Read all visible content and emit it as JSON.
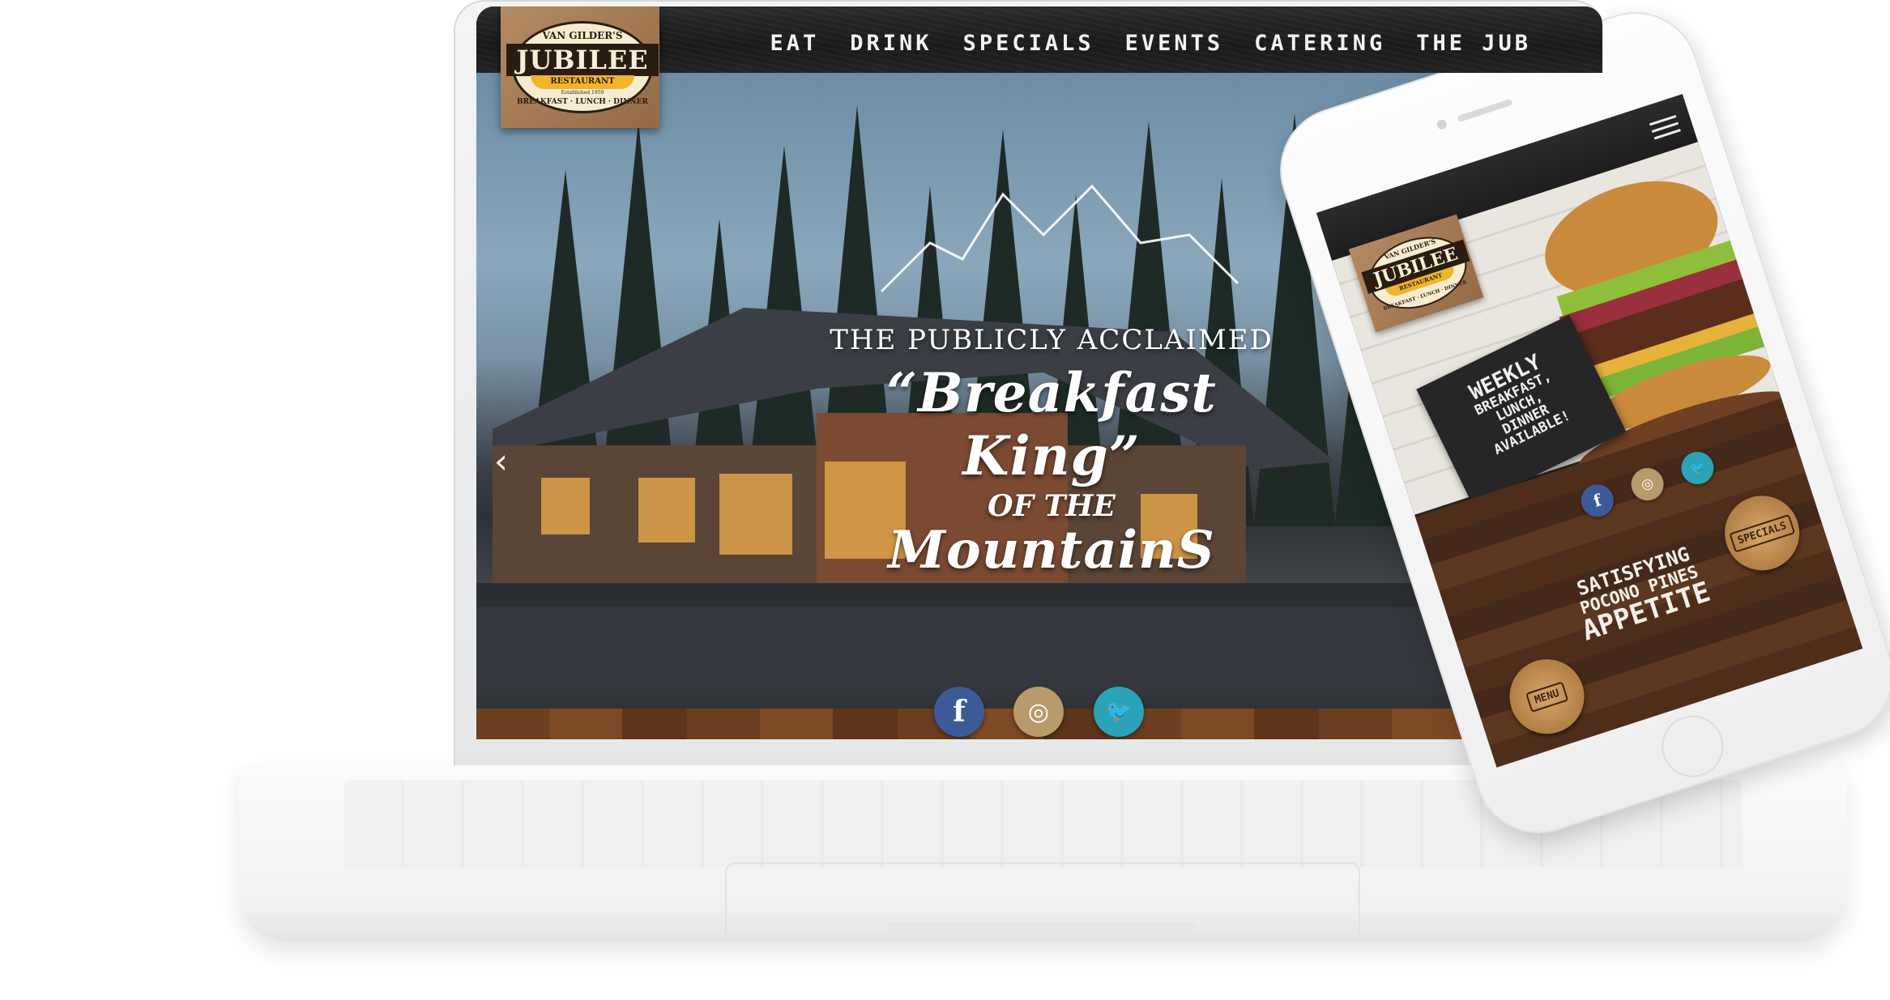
{
  "site": {
    "logo": {
      "top": "VAN GILDER'S",
      "main": "JUBILEE",
      "sub": "RESTAURANT",
      "established": "Established 1959",
      "bottom": "BREAKFAST · LUNCH · DINNER"
    },
    "nav": [
      "EAT",
      "DRINK",
      "SPECIALS",
      "EVENTS",
      "CATERING",
      "THE JUB"
    ],
    "hero": {
      "line1": "THE PUBLICLY ACCLAIMED",
      "line2": "“Breakfast King”",
      "line3": "OF THE",
      "line4": "MountainS"
    },
    "carousel_prev": "‹",
    "social": [
      {
        "name": "facebook",
        "glyph": "f",
        "color": "#3d5a98"
      },
      {
        "name": "instagram",
        "glyph": "◎",
        "color": "#b99a6a"
      },
      {
        "name": "twitter",
        "glyph": "🐦",
        "color": "#2aa3b8"
      }
    ]
  },
  "mobile": {
    "logo": {
      "top": "VAN GILDER'S",
      "main": "JUBILEE",
      "sub": "RESTAURANT",
      "bottom": "BREAKFAST · LUNCH · DINNER"
    },
    "promo": {
      "line1": "WEEKLY",
      "line2": "BREAKFAST,",
      "line3": "LUNCH,",
      "line4": "DINNER",
      "line5": "AVAILABLE!"
    },
    "buttons": {
      "specials": "SPECIALS",
      "menu": "MENU"
    },
    "tagline": {
      "l1": "SATISFYING",
      "l2": "POCONO PINES",
      "l3": "APPETITE"
    },
    "social": [
      {
        "name": "facebook",
        "glyph": "f",
        "color": "#3d5a98"
      },
      {
        "name": "instagram",
        "glyph": "◎",
        "color": "#b99a6a"
      },
      {
        "name": "twitter",
        "glyph": "🐦",
        "color": "#2aa3b8"
      }
    ]
  }
}
